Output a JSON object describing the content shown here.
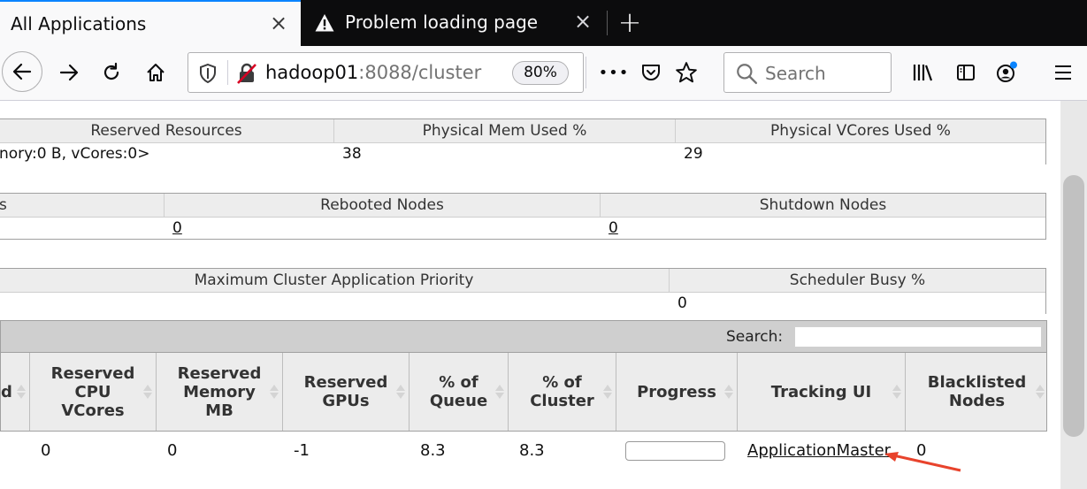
{
  "browser": {
    "tabs": [
      {
        "title": "All Applications",
        "close": "×"
      },
      {
        "title": "Problem loading page",
        "close": "×"
      }
    ],
    "new_tab": "+",
    "url": {
      "host": "hadoop01",
      "path": ":8088/cluster"
    },
    "zoom": "80%",
    "more": "•••",
    "search_placeholder": "Search",
    "colors": {
      "tabbar": "#0c0c0d",
      "accent": "#0a84ff",
      "warning": "#f9f9fa"
    }
  },
  "resources_table": {
    "headers": [
      "Reserved Resources",
      "Physical Mem Used %",
      "Physical VCores Used %"
    ],
    "values": [
      "nory:0 B, vCores:0>",
      "38",
      "29"
    ]
  },
  "nodes_table": {
    "headers": [
      "s",
      "Rebooted Nodes",
      "Shutdown Nodes"
    ],
    "values": [
      "",
      "0",
      "0"
    ]
  },
  "priority_table": {
    "headers": [
      "Maximum Cluster Application Priority",
      "Scheduler Busy %"
    ],
    "values": [
      "",
      "0"
    ]
  },
  "apps": {
    "search_label": "Search:",
    "search_value": "",
    "columns": [
      "d",
      "Reserved CPU VCores",
      "Reserved Memory MB",
      "Reserved GPUs",
      "% of Queue",
      "% of Cluster",
      "Progress",
      "Tracking UI",
      "Blacklisted Nodes"
    ],
    "rows": [
      {
        "reserved_cpu": "0",
        "reserved_mem": "0",
        "reserved_gpus": "-1",
        "pct_queue": "8.3",
        "pct_cluster": "8.3",
        "progress": 0,
        "tracking_ui": "ApplicationMaster",
        "blacklisted": "0"
      }
    ]
  }
}
